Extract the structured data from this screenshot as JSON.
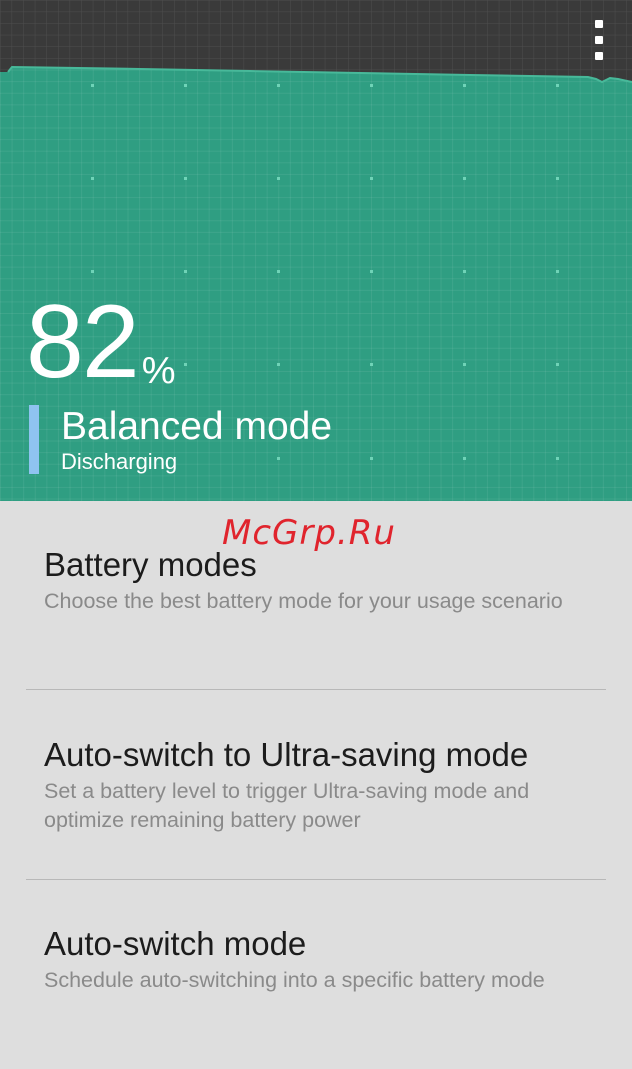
{
  "status": {
    "percent": "82",
    "percent_sign": "%",
    "mode_title": "Balanced mode",
    "mode_state": "Discharging"
  },
  "watermark": "McGrp.Ru",
  "settings": [
    {
      "title": "Battery modes",
      "description": "Choose the best battery mode for your usage scenario"
    },
    {
      "title": "Auto-switch to Ultra-saving mode",
      "description": "Set a battery level to trigger Ultra-saving mode and optimize remaining battery power"
    },
    {
      "title": "Auto-switch mode",
      "description": "Schedule auto-switching into a specific battery mode"
    }
  ],
  "colors": {
    "header_green": "#2f9e82",
    "mode_indicator": "#8fc3f0",
    "watermark_red": "#e0242d"
  },
  "icons": {
    "menu": "overflow-menu-icon"
  }
}
